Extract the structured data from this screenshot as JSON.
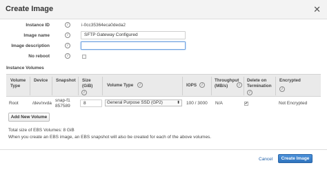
{
  "dialog": {
    "title": "Create Image",
    "close_label": "✕"
  },
  "form": {
    "instance_id_label": "Instance ID",
    "instance_id_value": "i-0cc35364eca0deda2",
    "image_name_label": "Image name",
    "image_name_value": "SFTP Gateway Configured",
    "image_description_label": "Image description",
    "image_description_value": "",
    "no_reboot_label": "No reboot",
    "no_reboot_checked": false
  },
  "volumes": {
    "section_title": "Instance Volumes",
    "columns": [
      "Volume Type",
      "Device",
      "Snapshot",
      "Size (GiB)",
      "Volume Type",
      "IOPS",
      "Throughput (MB/s)",
      "Delete on Termination",
      "Encrypted"
    ],
    "row": {
      "volume_type": "Root",
      "device": "/dev/xvda",
      "snapshot": "snap-f1857589",
      "size": "8",
      "volume_type_select": "General Purpose SSD (GP2)",
      "iops": "100 / 3000",
      "throughput": "N/A",
      "delete_on_termination": true,
      "encrypted": "Not Encrypted"
    },
    "add_button": "Add New Volume"
  },
  "summary": {
    "total_size": "Total size of EBS Volumes: 8 GiB",
    "note": "When you create an EBS image, an EBS snapshot will also be created for each of the above volumes."
  },
  "footer": {
    "cancel_button": "Cancel",
    "create_button": "Create Image"
  },
  "colors": {
    "primary": "#2f73bd",
    "header_bg": "#f3f3f3"
  }
}
